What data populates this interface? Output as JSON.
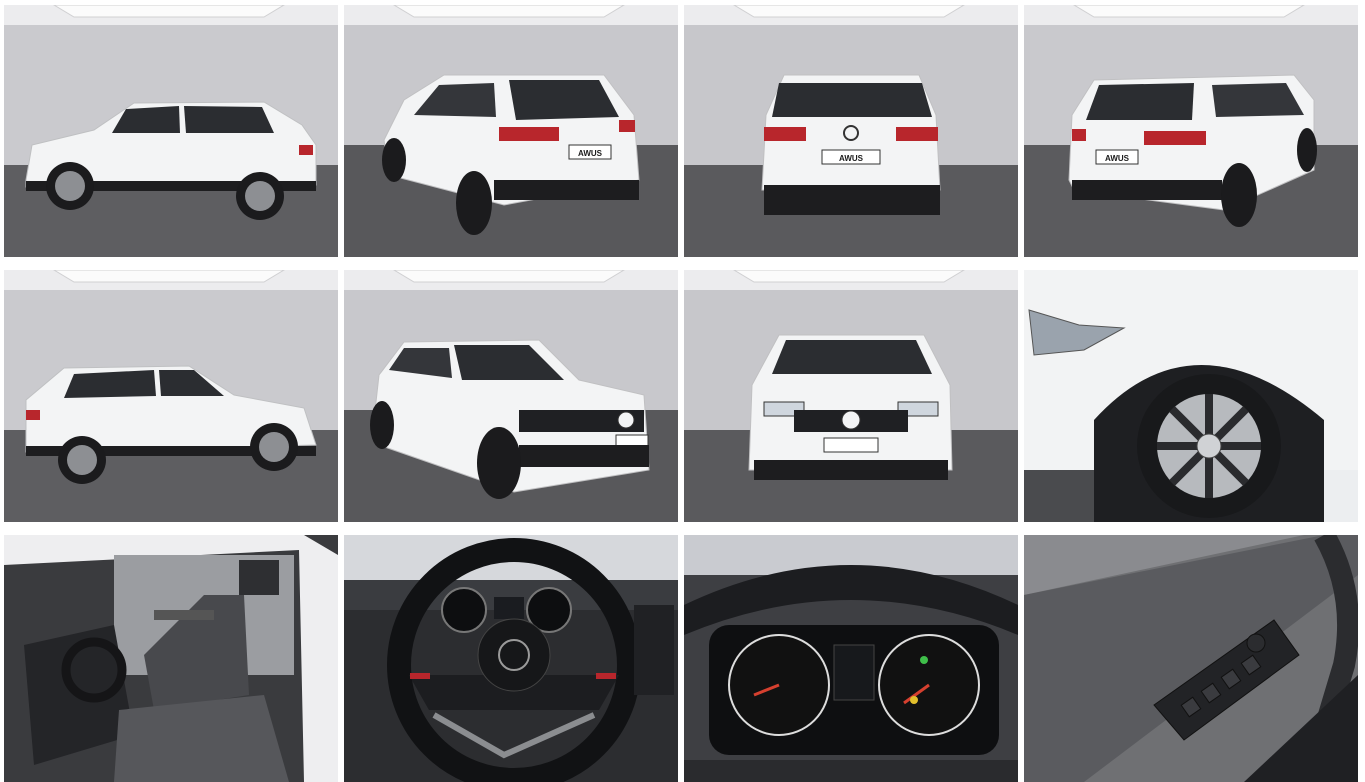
{
  "gallery": {
    "columns": 4,
    "rows": 3,
    "photos": [
      {
        "view": "side-left",
        "car": "white-suv"
      },
      {
        "view": "rear-three-quarter-left",
        "car": "white-suv"
      },
      {
        "view": "rear",
        "car": "white-suv"
      },
      {
        "view": "rear-three-quarter-right",
        "car": "white-suv"
      },
      {
        "view": "side-right",
        "car": "white-suv"
      },
      {
        "view": "front-three-quarter-right",
        "car": "white-suv"
      },
      {
        "view": "front",
        "car": "white-suv"
      },
      {
        "view": "wheel-detail",
        "car": "white-suv"
      },
      {
        "view": "interior-front-seats",
        "car": "white-suv"
      },
      {
        "view": "steering-wheel",
        "car": "white-suv"
      },
      {
        "view": "instrument-cluster",
        "car": "white-suv"
      },
      {
        "view": "door-window-switches",
        "car": "white-suv"
      }
    ]
  },
  "plate_text": "AWUS",
  "colors": {
    "studio_wall": "#c9c9cd",
    "studio_floor": "#5d5d60",
    "car_body": "#f4f5f6",
    "tail_light": "#b8262c",
    "interior_dark": "#2b2c2f"
  }
}
